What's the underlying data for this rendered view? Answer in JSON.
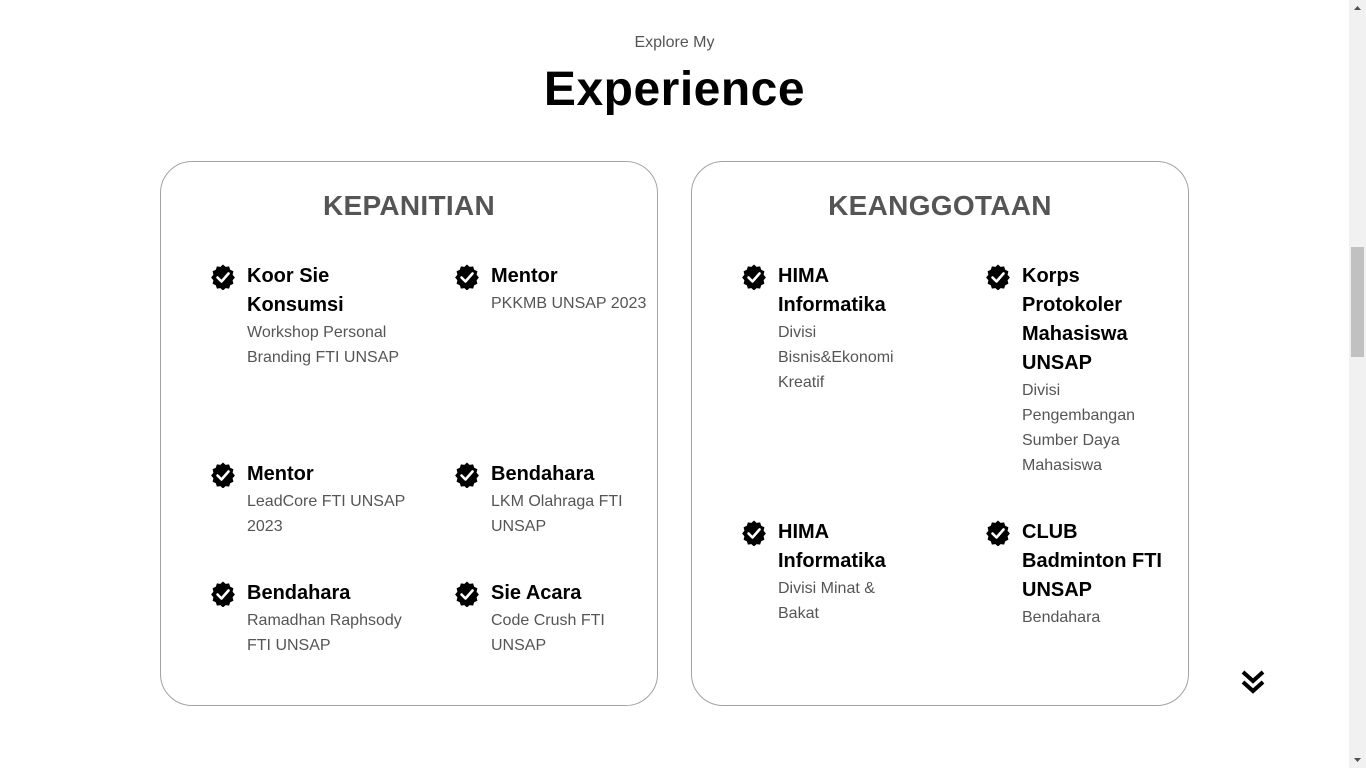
{
  "section": {
    "subtitle": "Explore My",
    "title": "Experience"
  },
  "kepanitian": {
    "title": "KEPANITIAN",
    "items": [
      {
        "role": "Koor Sie Konsumsi",
        "org": "Workshop Personal Branding FTI UNSAP"
      },
      {
        "role": "Mentor",
        "org": "PKKMB UNSAP 2023"
      },
      {
        "role": "Mentor",
        "org": "LeadCore FTI UNSAP 2023"
      },
      {
        "role": "Bendahara",
        "org": "LKM Olahraga FTI UNSAP"
      },
      {
        "role": "Bendahara",
        "org": "Ramadhan Raphsody FTI UNSAP"
      },
      {
        "role": "Sie Acara",
        "org": "Code Crush FTI UNSAP"
      }
    ]
  },
  "keanggotaan": {
    "title": "KEANGGOTAAN",
    "items": [
      {
        "role": "HIMA Informatika",
        "org": "Divisi Bisnis&Ekonomi Kreatif"
      },
      {
        "role": "Korps Protokoler Mahasiswa UNSAP",
        "org": "Divisi Pengembangan Sumber Daya Mahasiswa"
      },
      {
        "role": "HIMA Informatika",
        "org": "Divisi Minat & Bakat"
      },
      {
        "role": "CLUB Badminton FTI UNSAP",
        "org": "Bendahara"
      }
    ]
  },
  "icons": {
    "check": "check-badge-icon",
    "scroll": "double-chevron-down-icon"
  },
  "colors": {
    "accent": "#000000",
    "muted_text": "#555555",
    "card_border": "#a3a3a3"
  }
}
